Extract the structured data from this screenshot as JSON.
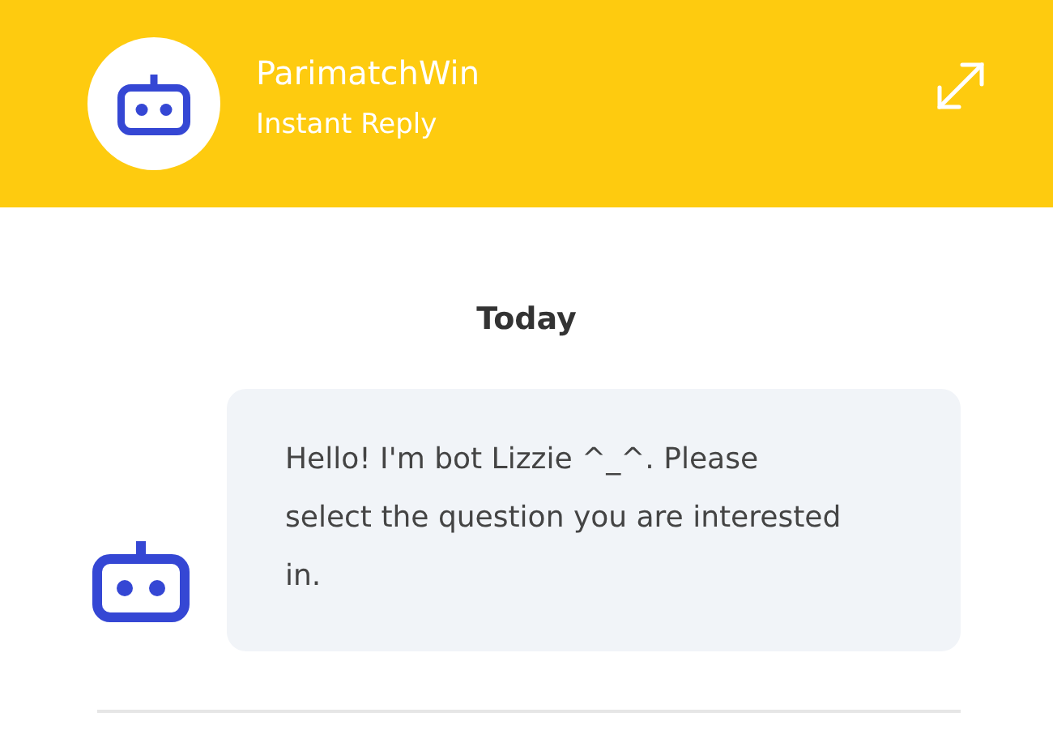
{
  "header": {
    "title": "ParimatchWin",
    "subtitle": "Instant Reply"
  },
  "date_divider": "Today",
  "messages": [
    {
      "kind": "bot",
      "text": "Hello! I'm bot Lizzie ^_^. Please select the question you are interested in."
    }
  ]
}
